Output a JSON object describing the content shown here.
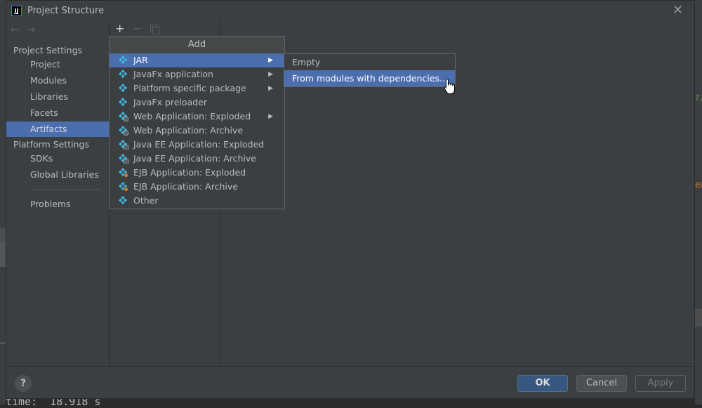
{
  "window": {
    "title": "Project Structure"
  },
  "sidebar": {
    "sections": [
      {
        "label": "Project Settings"
      },
      {
        "label": "Platform Settings"
      }
    ],
    "items": [
      {
        "label": "Project"
      },
      {
        "label": "Modules"
      },
      {
        "label": "Libraries"
      },
      {
        "label": "Facets"
      },
      {
        "label": "Artifacts",
        "selected": true
      },
      {
        "label": "SDKs"
      },
      {
        "label": "Global Libraries"
      },
      {
        "label": "Problems"
      }
    ]
  },
  "toolbar": {
    "add": "+",
    "remove": "−"
  },
  "add_popup": {
    "title": "Add",
    "items": [
      {
        "label": "JAR",
        "icon": "artifact-icon",
        "submenu": true,
        "selected": true
      },
      {
        "label": "JavaFx application",
        "icon": "artifact-icon",
        "submenu": true
      },
      {
        "label": "Platform specific package",
        "icon": "artifact-icon",
        "submenu": true
      },
      {
        "label": "JavaFx preloader",
        "icon": "artifact-icon"
      },
      {
        "label": "Web Application: Exploded",
        "icon": "web-artifact-icon",
        "submenu": true
      },
      {
        "label": "Web Application: Archive",
        "icon": "web-artifact-icon"
      },
      {
        "label": "Java EE Application: Exploded",
        "icon": "javaee-artifact-icon"
      },
      {
        "label": "Java EE Application: Archive",
        "icon": "javaee-artifact-icon"
      },
      {
        "label": "EJB Application: Exploded",
        "icon": "ejb-artifact-icon"
      },
      {
        "label": "EJB Application: Archive",
        "icon": "ejb-artifact-icon"
      },
      {
        "label": "Other",
        "icon": "artifact-icon"
      }
    ]
  },
  "jar_submenu": {
    "items": [
      {
        "label": "Empty"
      },
      {
        "label": "From modules with dependencies...",
        "selected": true
      }
    ]
  },
  "footer": {
    "help": "?",
    "ok": "OK",
    "cancel": "Cancel",
    "apply": "Apply"
  },
  "background": {
    "console_text": "time:  18.918 s",
    "editor_green": "t/",
    "editor_orange": "ea"
  },
  "colors": {
    "selection": "#4b6eaf",
    "dialog_bg": "#3c3f41",
    "ok_button": "#365880"
  }
}
